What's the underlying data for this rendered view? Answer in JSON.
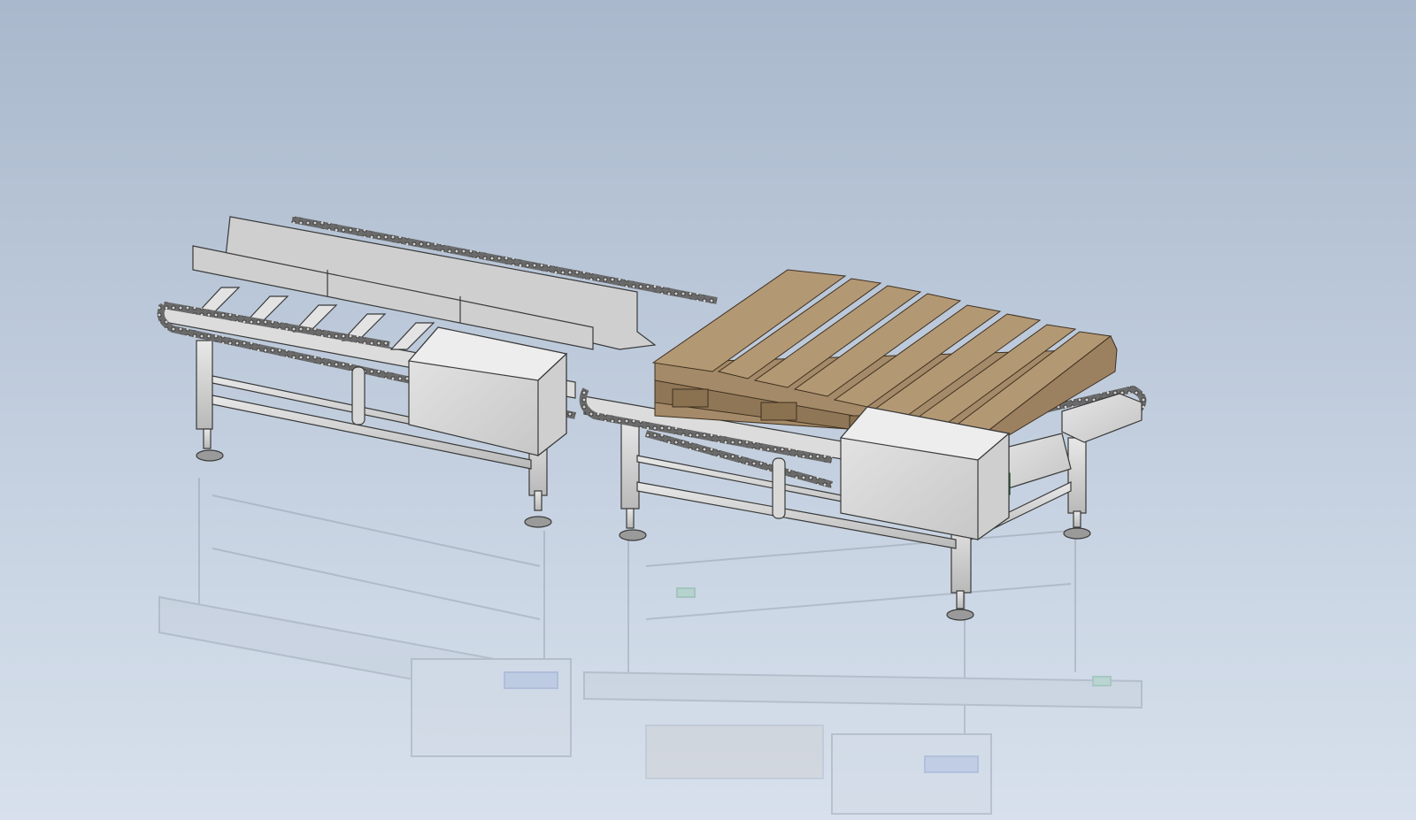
{
  "viewport": {
    "background_top": "#a9b8cc",
    "background_bottom": "#d7e0ec"
  },
  "model": {
    "frame_color": "#d4d4d4",
    "frame_edge_color": "#3a3a3a",
    "pallet_color": "#a48a68",
    "pallet_top_color": "#b39874",
    "chain_color": "#555555",
    "motor_accent_color": "#1e8a3a",
    "reflection_opacity": 0.28
  }
}
